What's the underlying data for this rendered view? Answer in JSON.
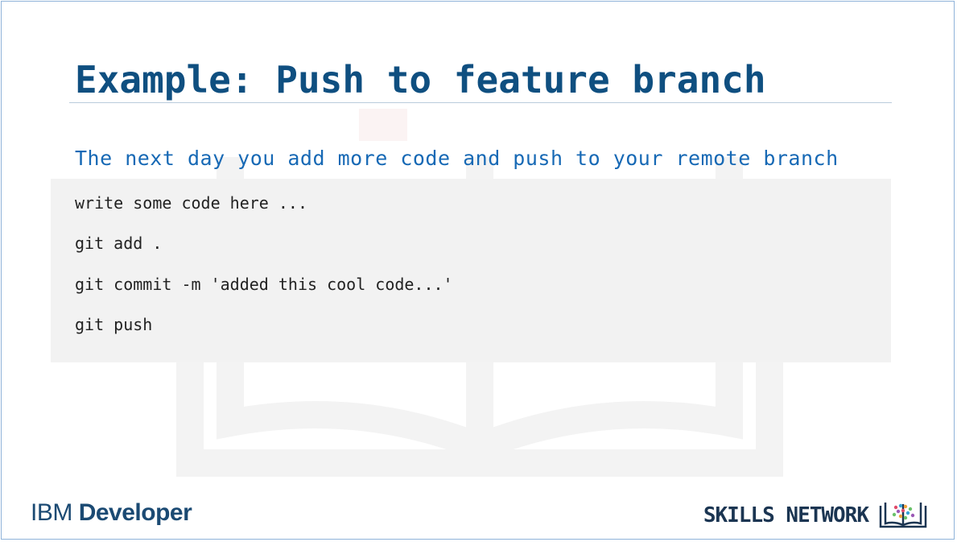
{
  "slide": {
    "title": "Example: Push to feature branch",
    "subtitle": "The next day you add more code and push to your remote branch",
    "code_lines": [
      "write some code here ...",
      "git add .",
      "git commit -m 'added this cool code...'",
      "git push"
    ]
  },
  "footer": {
    "brand": "IBM",
    "product": "Developer",
    "network": "SKILLS NETWORK",
    "logo_icon": "open-book-icon"
  },
  "colors": {
    "title": "#0f4f80",
    "subtitle": "#1769b5",
    "code_background": "#f2f2f2",
    "footer_text": "#1b4a73"
  }
}
